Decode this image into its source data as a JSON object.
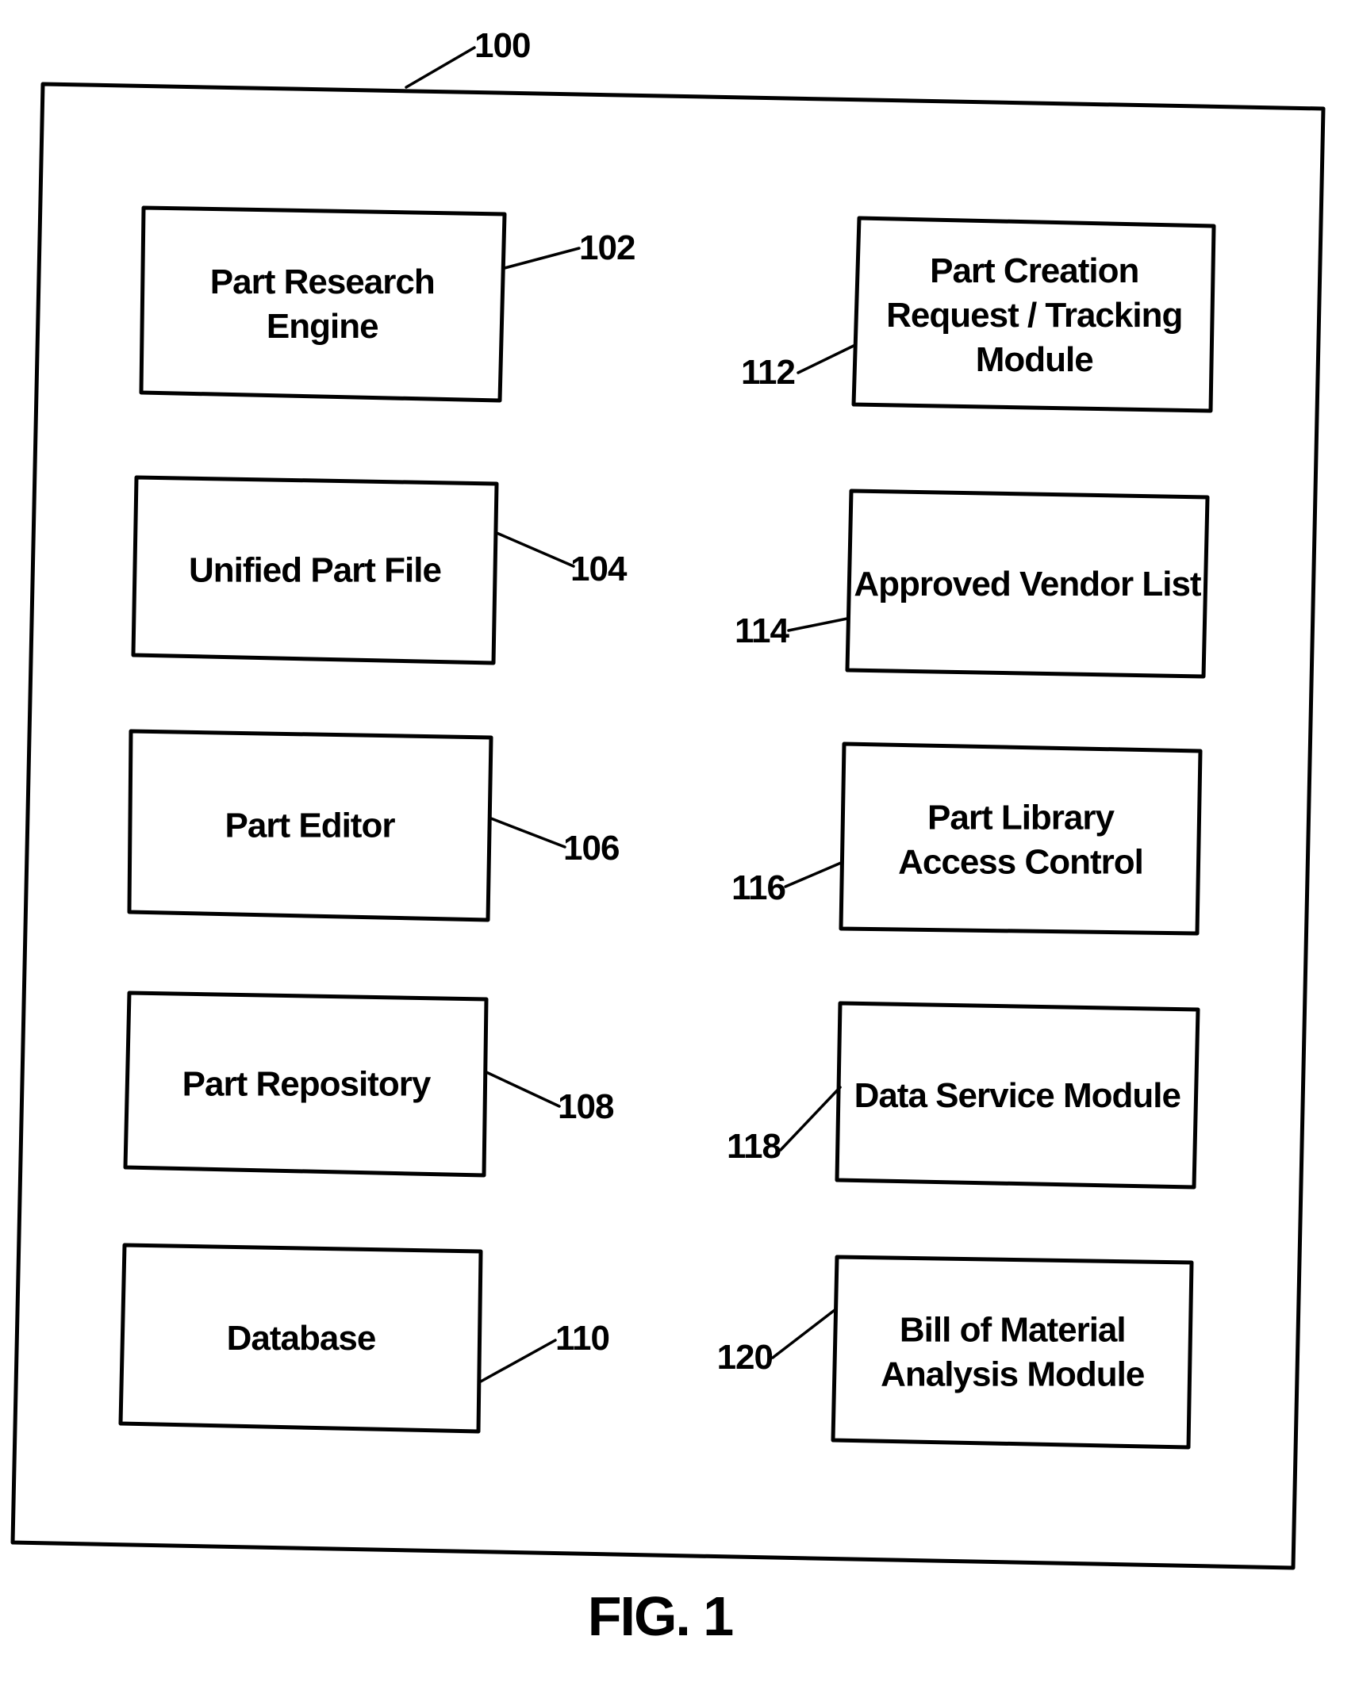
{
  "figure": {
    "caption": "FIG. 1",
    "system_ref": "100"
  },
  "modules": [
    {
      "id": "part-research-engine",
      "ref": "102",
      "lines": [
        "Part Research",
        "Engine"
      ],
      "column": "left"
    },
    {
      "id": "unified-part-file",
      "ref": "104",
      "lines": [
        "Unified Part File"
      ],
      "column": "left"
    },
    {
      "id": "part-editor",
      "ref": "106",
      "lines": [
        "Part Editor"
      ],
      "column": "left"
    },
    {
      "id": "part-repository",
      "ref": "108",
      "lines": [
        "Part Repository"
      ],
      "column": "left"
    },
    {
      "id": "database",
      "ref": "110",
      "lines": [
        "Database"
      ],
      "column": "left"
    },
    {
      "id": "part-creation-request-tracking-module",
      "ref": "112",
      "lines": [
        "Part Creation",
        "Request / Tracking",
        "Module"
      ],
      "column": "right"
    },
    {
      "id": "approved-vendor-list",
      "ref": "114",
      "lines": [
        "Approved Vendor List"
      ],
      "column": "right"
    },
    {
      "id": "part-library-access-control",
      "ref": "116",
      "lines": [
        "Part Library",
        "Access Control"
      ],
      "column": "right"
    },
    {
      "id": "data-service-module",
      "ref": "118",
      "lines": [
        "Data Service Module"
      ],
      "column": "right"
    },
    {
      "id": "bill-of-material-analysis-module",
      "ref": "120",
      "lines": [
        "Bill of Material",
        "Analysis Module"
      ],
      "column": "right"
    }
  ]
}
